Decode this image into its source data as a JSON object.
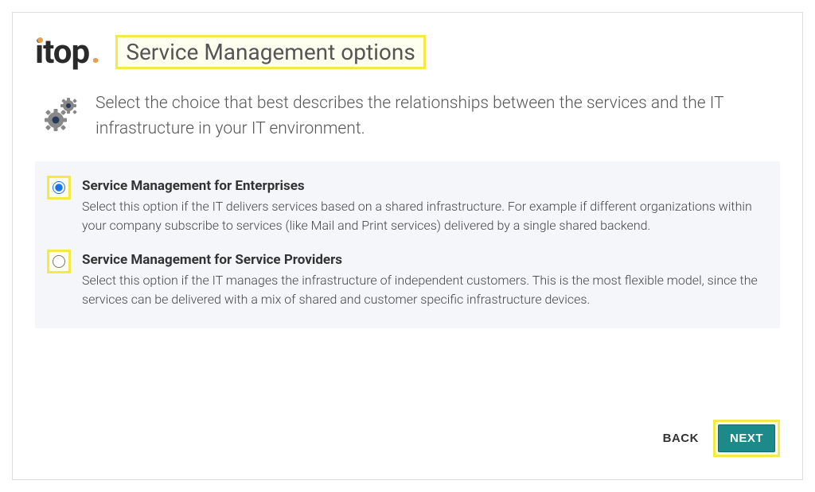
{
  "logo": {
    "text": "itop",
    "period": "."
  },
  "title": "Service Management options",
  "intro": "Select the choice that best describes the relationships between the services and the IT infrastructure in your IT environment.",
  "options": [
    {
      "label": "Service Management for Enterprises",
      "description": "Select this option if the IT delivers services based on a shared infrastructure. For example if different organizations within your company subscribe to services (like Mail and Print services) delivered by a single shared backend.",
      "selected": true
    },
    {
      "label": "Service Management for Service Providers",
      "description": "Select this option if the IT manages the infrastructure of independent customers. This is the most flexible model, since the services can be delivered with a mix of shared and customer specific infrastructure devices.",
      "selected": false
    }
  ],
  "buttons": {
    "back": "BACK",
    "next": "NEXT"
  }
}
